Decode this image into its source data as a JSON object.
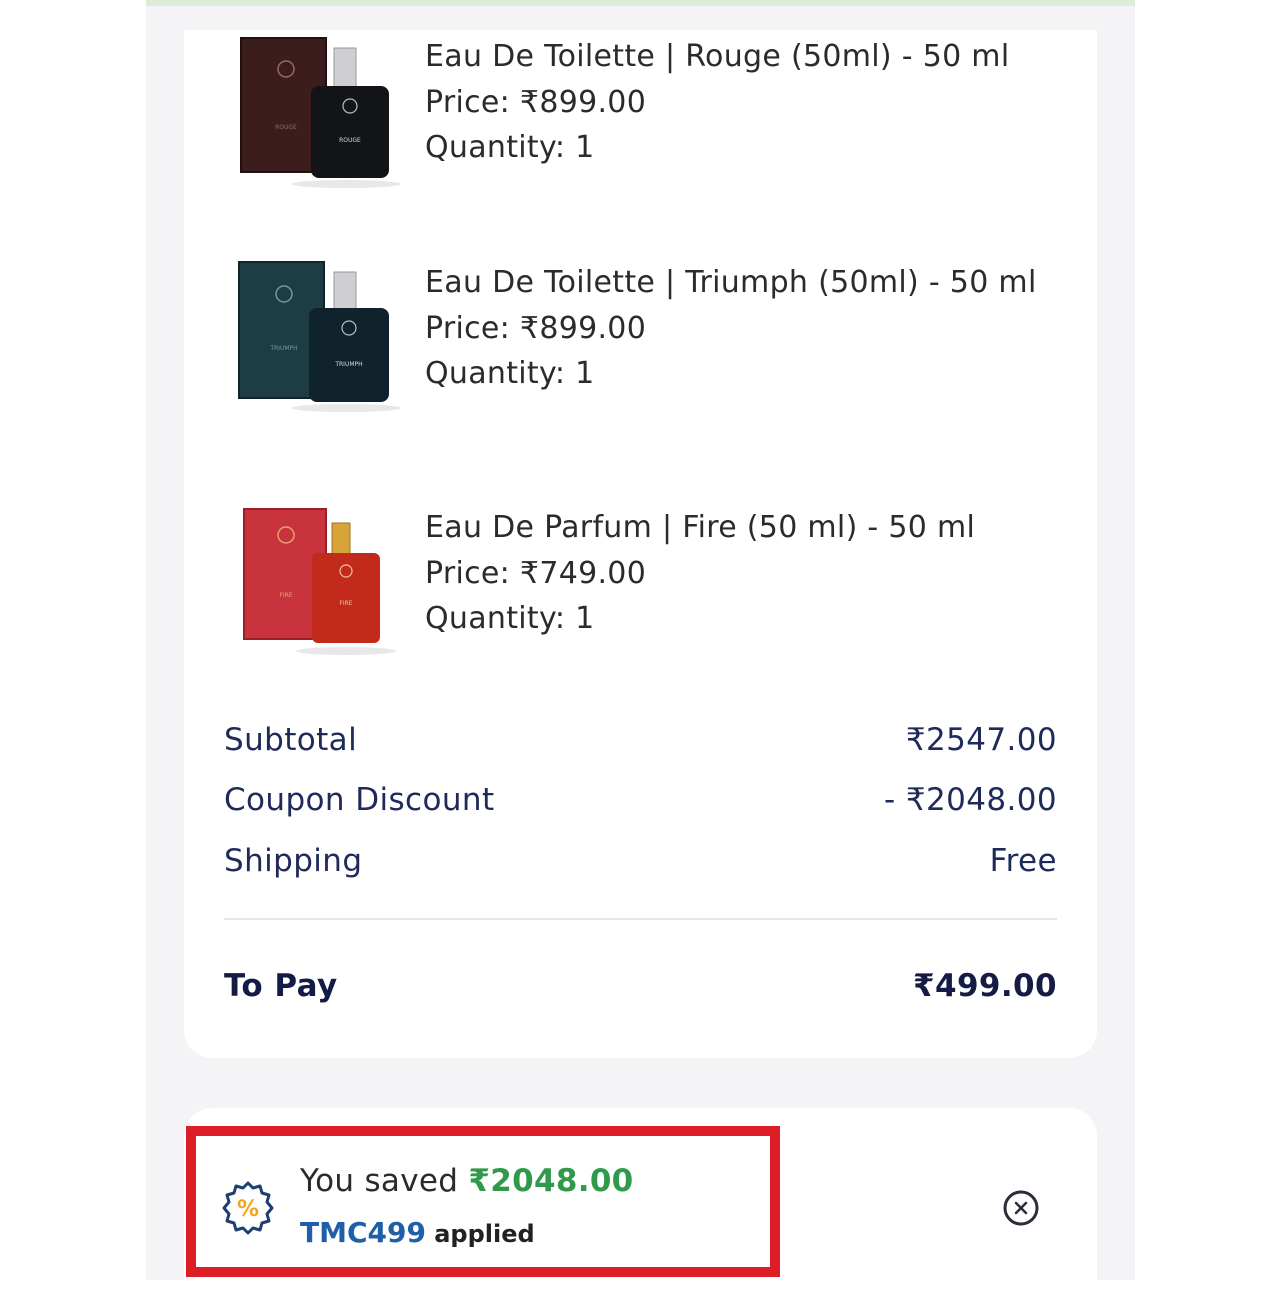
{
  "items": [
    {
      "name": "Eau De Toilette | Rouge (50ml) - 50 ml",
      "price": "Price: ₹899.00",
      "quantity": "Quantity: 1",
      "box_color": "#3b1d1e",
      "bottle_color": "#121418",
      "label": "ROUGE"
    },
    {
      "name": "Eau De Toilette | Triumph (50ml) - 50 ml",
      "price": "Price: ₹899.00",
      "quantity": "Quantity: 1",
      "box_color": "#1d3c44",
      "bottle_color": "#10222c",
      "label": "TRIUMPH"
    },
    {
      "name": "Eau De Parfum | Fire (50 ml) - 50 ml",
      "price": "Price: ₹749.00",
      "quantity": "Quantity: 1",
      "box_color": "#c8333d",
      "bottle_color": "#c22a1c",
      "label": "FIRE"
    }
  ],
  "summary": {
    "subtotal_label": "Subtotal",
    "subtotal_value": "₹2547.00",
    "discount_label": "Coupon Discount",
    "discount_value": "- ₹2048.00",
    "shipping_label": "Shipping",
    "shipping_value": "Free",
    "topay_label": "To Pay",
    "topay_value": "₹499.00"
  },
  "coupon": {
    "saved_prefix": "You saved",
    "saved_amount": "₹2048.00",
    "code": "TMC499",
    "applied_text": "applied",
    "icon": "percent-badge-icon",
    "close_icon": "close-circle-icon"
  },
  "colors": {
    "accent_green": "#2e9a4a",
    "code_blue": "#1e5fa8",
    "navy": "#1e2a5a",
    "highlight_red": "#dd1d26"
  }
}
